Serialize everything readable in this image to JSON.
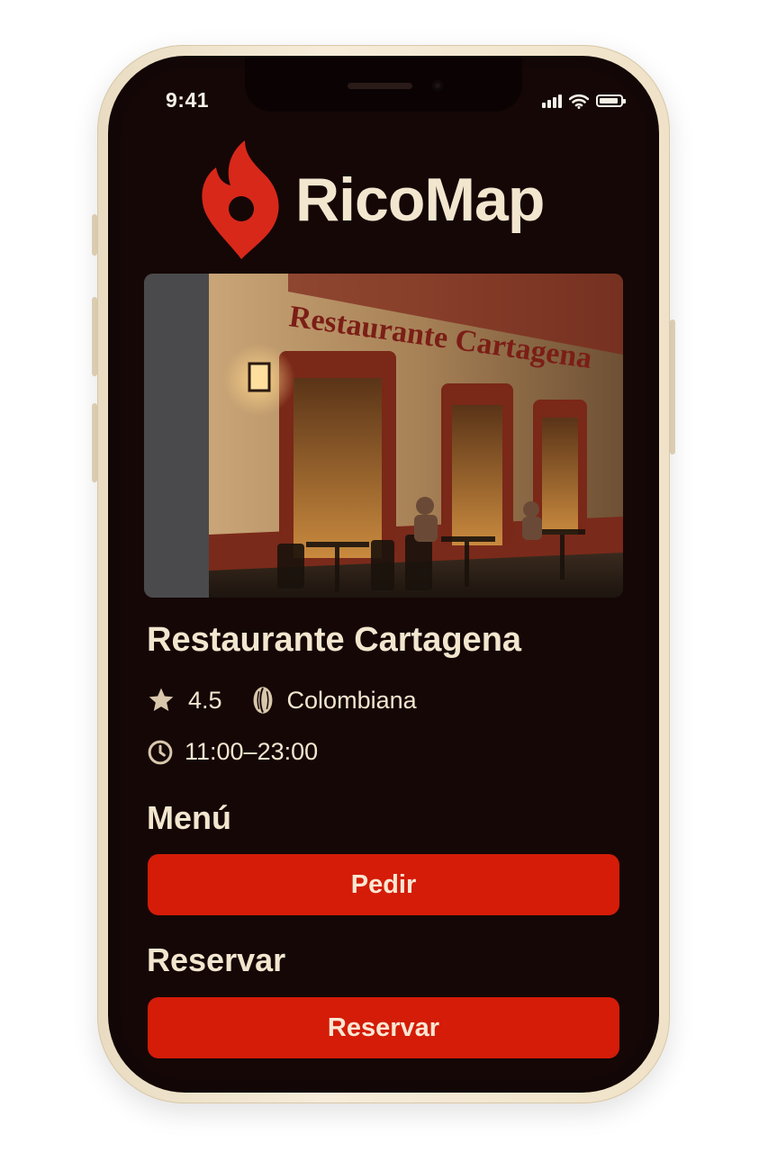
{
  "status_bar": {
    "time": "9:41",
    "icons": [
      "signal-icon",
      "wifi-icon",
      "battery-icon"
    ]
  },
  "header": {
    "brand_name": "RicoMap",
    "logo_icon": "flame-pin-icon",
    "brand_color": "#d8281a"
  },
  "restaurant": {
    "photo_sign_text": "Restaurante Cartagena",
    "name": "Restaurante Cartagena",
    "rating": "4.5",
    "rating_icon": "star-icon",
    "cuisine": "Colombiana",
    "cuisine_icon": "cacao-bean-icon",
    "hours": "11:00–23:00",
    "hours_icon": "clock-icon"
  },
  "menu_section": {
    "heading": "Menú",
    "button_label": "Pedir"
  },
  "reserve_section": {
    "heading": "Reservar",
    "button_label": "Reservar"
  },
  "colors": {
    "background": "#150706",
    "text": "#f3e6cf",
    "accent_button": "#d41c08",
    "phone_frame": "#efe2c8"
  }
}
